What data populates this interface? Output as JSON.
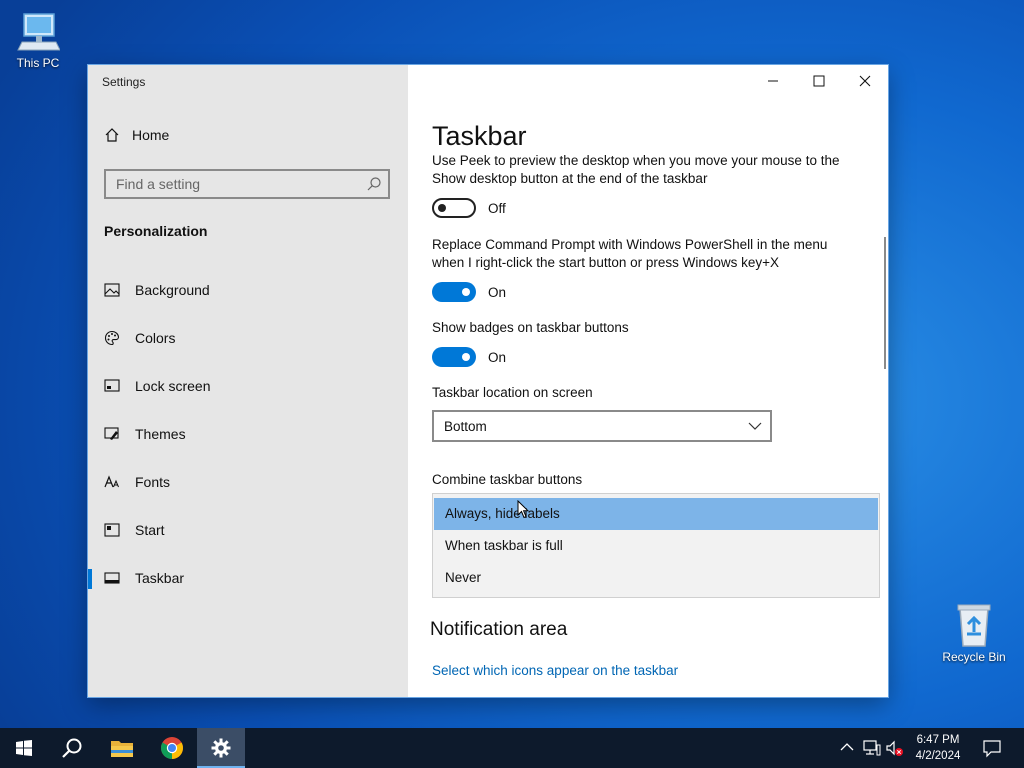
{
  "desktop": {
    "icons": [
      {
        "label": "This PC",
        "icon": "computer-icon"
      },
      {
        "label": "Recycle Bin",
        "icon": "recycle-bin-icon"
      }
    ]
  },
  "window": {
    "title": "Settings",
    "controls": {
      "minimize": "minimize-icon",
      "maximize": "maximize-icon",
      "close": "close-icon"
    }
  },
  "sidebar": {
    "home_label": "Home",
    "search_placeholder": "Find a setting",
    "section_heading": "Personalization",
    "items": [
      {
        "label": "Background",
        "icon": "picture-icon",
        "active": false
      },
      {
        "label": "Colors",
        "icon": "palette-icon",
        "active": false
      },
      {
        "label": "Lock screen",
        "icon": "lock-screen-icon",
        "active": false
      },
      {
        "label": "Themes",
        "icon": "brush-icon",
        "active": false
      },
      {
        "label": "Fonts",
        "icon": "font-icon",
        "active": false
      },
      {
        "label": "Start",
        "icon": "start-icon",
        "active": false
      },
      {
        "label": "Taskbar",
        "icon": "taskbar-icon",
        "active": true
      }
    ]
  },
  "main": {
    "title": "Taskbar",
    "peek": {
      "line1": "Use Peek to preview the desktop when you move your mouse to the",
      "line2": "Show desktop button at the end of the taskbar",
      "state": "Off"
    },
    "powershell": {
      "line1": "Replace Command Prompt with Windows PowerShell in the menu",
      "line2": "when I right-click the start button or press Windows key+X",
      "state": "On"
    },
    "badges": {
      "label": "Show badges on taskbar buttons",
      "state": "On"
    },
    "location": {
      "label": "Taskbar location on screen",
      "value": "Bottom"
    },
    "combine": {
      "label": "Combine taskbar buttons",
      "options": [
        "Always, hide labels",
        "When taskbar is full",
        "Never"
      ],
      "selected": "Always, hide labels"
    },
    "notification_heading": "Notification area",
    "notification_link": "Select which icons appear on the taskbar"
  },
  "taskbar": {
    "apps": [
      "windows-start-icon",
      "search-icon",
      "file-explorer-icon",
      "chrome-icon",
      "settings-icon"
    ],
    "time": "6:47 PM",
    "date": "4/2/2024"
  },
  "colors": {
    "accent": "#0078d7",
    "link": "#0066b4",
    "selection": "#7db4e8"
  }
}
